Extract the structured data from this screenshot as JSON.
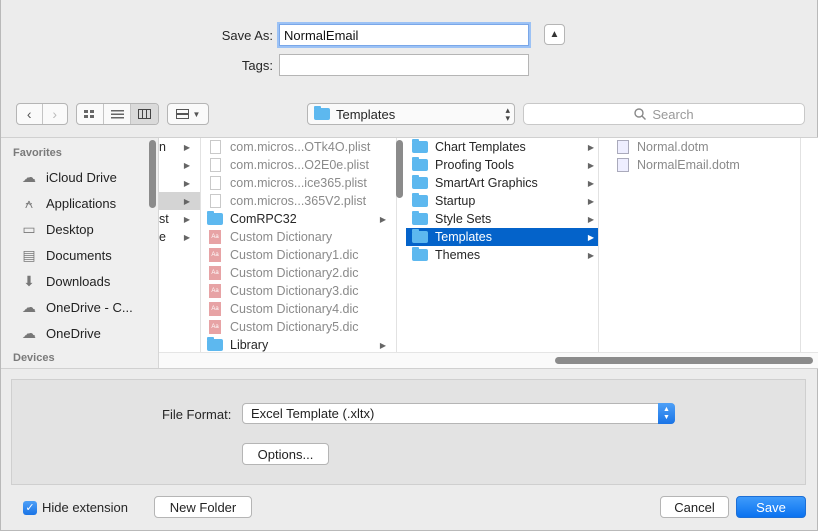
{
  "save_as": {
    "label": "Save As:",
    "value": "NormalEmail"
  },
  "tags": {
    "label": "Tags:",
    "value": ""
  },
  "toolbar": {
    "location": "Templates",
    "search_placeholder": "Search"
  },
  "sidebar": {
    "favorites_header": "Favorites",
    "favorites": [
      {
        "label": "iCloud Drive",
        "icon": "cloud-icon"
      },
      {
        "label": "Applications",
        "icon": "applications-icon"
      },
      {
        "label": "Desktop",
        "icon": "desktop-icon"
      },
      {
        "label": "Documents",
        "icon": "documents-icon"
      },
      {
        "label": "Downloads",
        "icon": "downloads-icon"
      },
      {
        "label": "OneDrive - C...",
        "icon": "cloud-icon"
      },
      {
        "label": "OneDrive",
        "icon": "cloud-icon"
      }
    ],
    "devices_header": "Devices"
  },
  "columns": {
    "col1_fragments": [
      "n",
      "",
      "",
      "",
      "st",
      "e"
    ],
    "col2": [
      {
        "label": "com.micros...OTk4O.plist",
        "type": "plist"
      },
      {
        "label": "com.micros...O2E0e.plist",
        "type": "plist"
      },
      {
        "label": "com.micros...ice365.plist",
        "type": "plist"
      },
      {
        "label": "com.micros...365V2.plist",
        "type": "plist"
      },
      {
        "label": "ComRPC32",
        "type": "folder"
      },
      {
        "label": "Custom Dictionary",
        "type": "dic"
      },
      {
        "label": "Custom Dictionary1.dic",
        "type": "dic"
      },
      {
        "label": "Custom Dictionary2.dic",
        "type": "dic"
      },
      {
        "label": "Custom Dictionary3.dic",
        "type": "dic"
      },
      {
        "label": "Custom Dictionary4.dic",
        "type": "dic"
      },
      {
        "label": "Custom Dictionary5.dic",
        "type": "dic"
      },
      {
        "label": "Library",
        "type": "folder"
      }
    ],
    "col3": [
      {
        "label": "Chart Templates"
      },
      {
        "label": "Proofing Tools"
      },
      {
        "label": "SmartArt Graphics"
      },
      {
        "label": "Startup"
      },
      {
        "label": "Style Sets"
      },
      {
        "label": "Templates",
        "selected": true
      },
      {
        "label": "Themes"
      }
    ],
    "col4": [
      {
        "label": "Normal.dotm"
      },
      {
        "label": "NormalEmail.dotm"
      }
    ]
  },
  "accessory": {
    "file_format_label": "File Format:",
    "file_format_value": "Excel Template (.xltx)",
    "options_label": "Options..."
  },
  "footer": {
    "hide_extension_label": "Hide extension",
    "hide_extension_checked": true,
    "new_folder_label": "New Folder",
    "cancel_label": "Cancel",
    "save_label": "Save"
  }
}
